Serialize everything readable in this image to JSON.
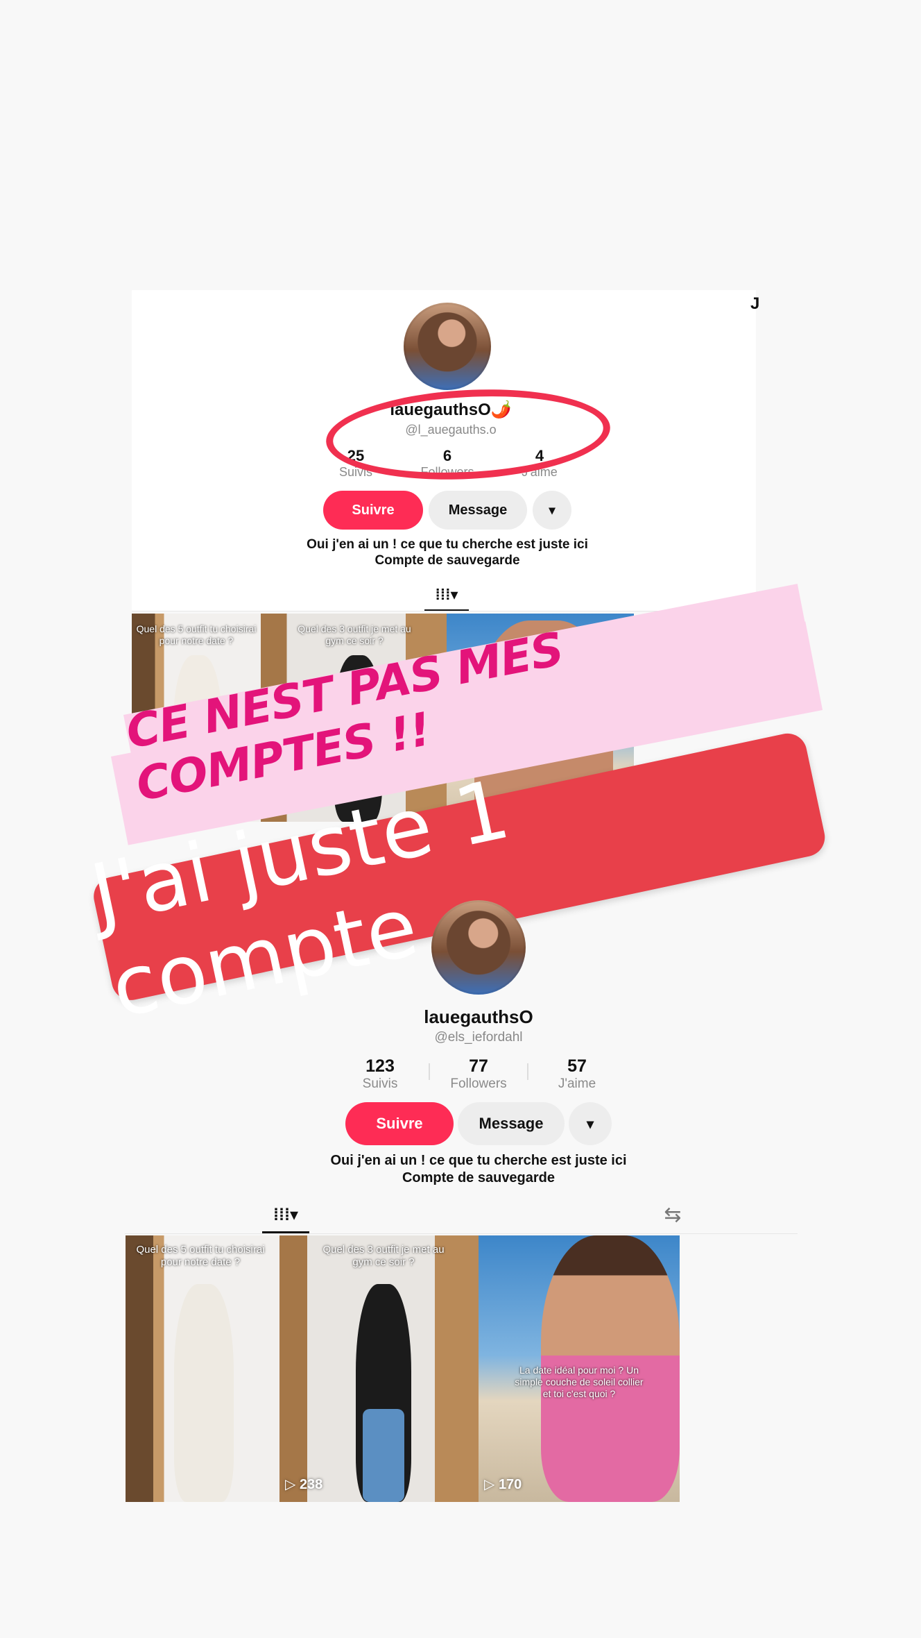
{
  "top_profile": {
    "name": "lauegauthsO",
    "emoji": "🌶️",
    "handle": "@l_auegauths.o",
    "stats": [
      {
        "num": "25",
        "label": "Suivis"
      },
      {
        "num": "6",
        "label": "Followers"
      },
      {
        "num": "4",
        "label": "J'aime"
      }
    ],
    "follow_label": "Suivre",
    "message_label": "Message",
    "more_label": "▾",
    "bio_line1": "Oui j'en ai un ! ce que tu cherche est juste ici",
    "bio_line2": "Compte de sauvegarde",
    "grid_tab": "⁞⁞⁞▾",
    "videos": [
      {
        "caption": "Quel des 5 outfit tu choisirai pour notre date ?"
      },
      {
        "caption": "Quel des 3 outfit je met au gym ce soir ?"
      },
      {
        "caption": ""
      }
    ]
  },
  "overlay": {
    "pink_text": "CE NEST PAS MES COMPTES !!",
    "red_text": "J'ai juste 1 compte",
    "corner_mark": "J"
  },
  "bottom_profile": {
    "name": "lauegauthsO",
    "handle": "@els_iefordahl",
    "stats": [
      {
        "num": "123",
        "label": "Suivis"
      },
      {
        "num": "77",
        "label": "Followers"
      },
      {
        "num": "57",
        "label": "J'aime"
      }
    ],
    "follow_label": "Suivre",
    "message_label": "Message",
    "more_label": "▾",
    "bio_line1": "Oui j'en ai un ! ce que tu cherche est juste ici",
    "bio_line2": "Compte de sauvegarde",
    "grid_tab": "⁞⁞⁞▾",
    "repost_icon": "⇆",
    "videos": [
      {
        "caption": "Quel des 5 outfit tu choisirai pour notre date ?",
        "views": ""
      },
      {
        "caption": "Quel des 3 outfit je met au gym ce soir ?",
        "views": "▷ 238"
      },
      {
        "caption": "La date idéal pour moi ? Un simple couche de soleil collier et toi c'est quoi ?",
        "views": "▷ 170"
      }
    ]
  }
}
